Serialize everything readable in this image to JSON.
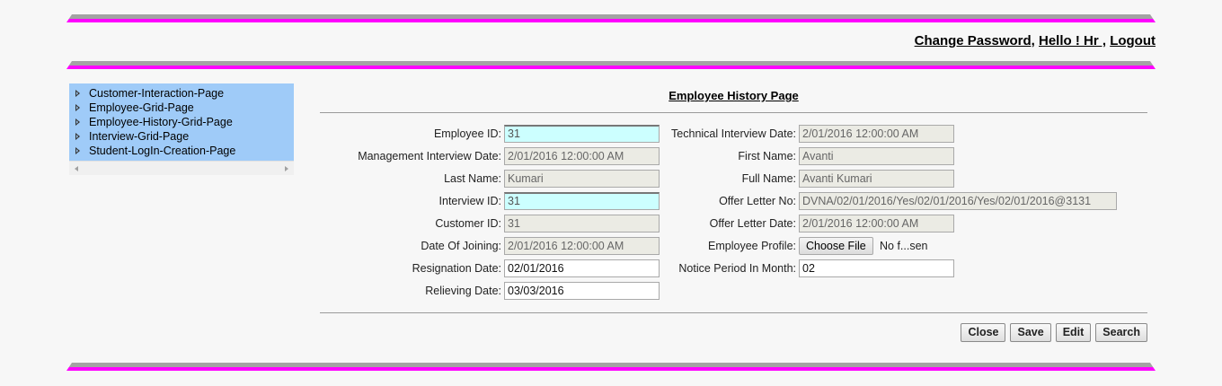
{
  "header": {
    "change_password": "Change Password,",
    "hello": "Hello ! Hr ,",
    "logout": "Logout"
  },
  "sidebar": {
    "items": [
      {
        "label": "Customer-Interaction-Page"
      },
      {
        "label": "Employee-Grid-Page"
      },
      {
        "label": "Employee-History-Grid-Page"
      },
      {
        "label": "Interview-Grid-Page"
      },
      {
        "label": "Student-LogIn-Creation-Page"
      }
    ]
  },
  "page": {
    "title": "Employee History Page"
  },
  "form": {
    "employee_id": {
      "label": "Employee ID:",
      "value": "31"
    },
    "management_interview_date": {
      "label": "Management Interview Date:",
      "value": "2/01/2016 12:00:00 AM"
    },
    "last_name": {
      "label": "Last Name:",
      "value": "Kumari"
    },
    "interview_id": {
      "label": "Interview ID:",
      "value": "31"
    },
    "customer_id": {
      "label": "Customer ID:",
      "value": "31"
    },
    "date_of_joining": {
      "label": "Date Of Joining:",
      "value": "2/01/2016 12:00:00 AM"
    },
    "resignation_date": {
      "label": "Resignation Date:",
      "value": "02/01/2016"
    },
    "relieving_date": {
      "label": "Relieving Date:",
      "value": "03/03/2016"
    },
    "technical_interview_date": {
      "label": "Technical Interview Date:",
      "value": "2/01/2016 12:00:00 AM"
    },
    "first_name": {
      "label": "First Name:",
      "value": "Avanti"
    },
    "full_name": {
      "label": "Full Name:",
      "value": "Avanti Kumari"
    },
    "offer_letter_no": {
      "label": "Offer Letter No:",
      "value": "DVNA/02/01/2016/Yes/02/01/2016/Yes/02/01/2016@3131"
    },
    "offer_letter_date": {
      "label": "Offer Letter Date:",
      "value": "2/01/2016 12:00:00 AM"
    },
    "employee_profile": {
      "label": "Employee Profile:",
      "button": "Choose File",
      "status": "No f...sen"
    },
    "notice_period": {
      "label": "Notice Period In Month:",
      "value": "02"
    }
  },
  "actions": {
    "close": "Close",
    "save": "Save",
    "edit": "Edit",
    "search": "Search"
  },
  "colors": {
    "accent_bar": "#ff00ff",
    "bar_gray": "#a3a3a3",
    "sidebar_bg": "#9fcbf8",
    "highlight_field": "#ccffff"
  }
}
